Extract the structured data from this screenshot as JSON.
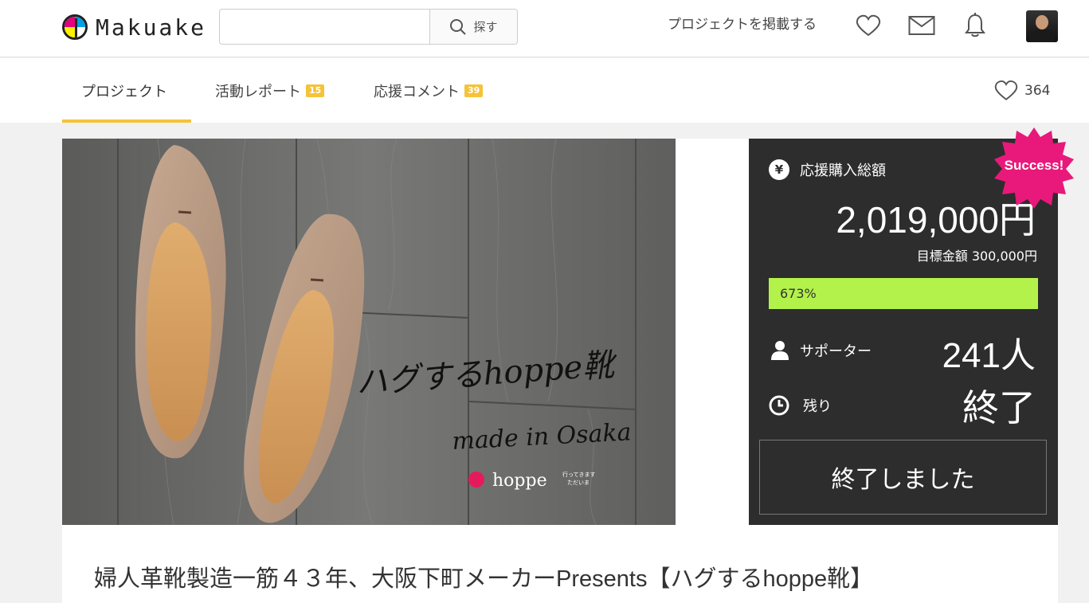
{
  "header": {
    "logo_text": "Makuake",
    "search": {
      "placeholder": "",
      "button_label": "探す"
    },
    "post_project_label": "プロジェクトを掲載する",
    "icons": [
      "heart-icon",
      "mail-icon",
      "bell-icon"
    ]
  },
  "tabs": [
    {
      "label": "プロジェクト",
      "badge": null,
      "active": true
    },
    {
      "label": "活動レポート",
      "badge": "15",
      "active": false
    },
    {
      "label": "応援コメント",
      "badge": "39",
      "active": false
    }
  ],
  "likes_count": "364",
  "hero": {
    "headline": "ハグするhoppe靴",
    "sub": "made in Osaka",
    "brand": "hoppe",
    "brand_tagline_1": "行ってきます",
    "brand_tagline_2": "ただいま"
  },
  "funding": {
    "total_label": "応援購入総額",
    "total_value": "2,019,000円",
    "goal_text": "目標金額 300,000円",
    "progress_label": "673%",
    "progress_percent": 673,
    "supporters_label": "サポーター",
    "supporters_value": "241人",
    "remaining_label": "残り",
    "remaining_value": "終了",
    "status_button_label": "終了しました",
    "success_badge": "Success!"
  },
  "project_title": "婦人革靴製造一筋４３年、大阪下町メーカーPresents【ハグするhoppe靴】",
  "colors": {
    "accent_yellow": "#f5c339",
    "progress_green": "#b3f24a",
    "panel_bg": "#2d2d2d",
    "success_pink": "#e8197a"
  }
}
